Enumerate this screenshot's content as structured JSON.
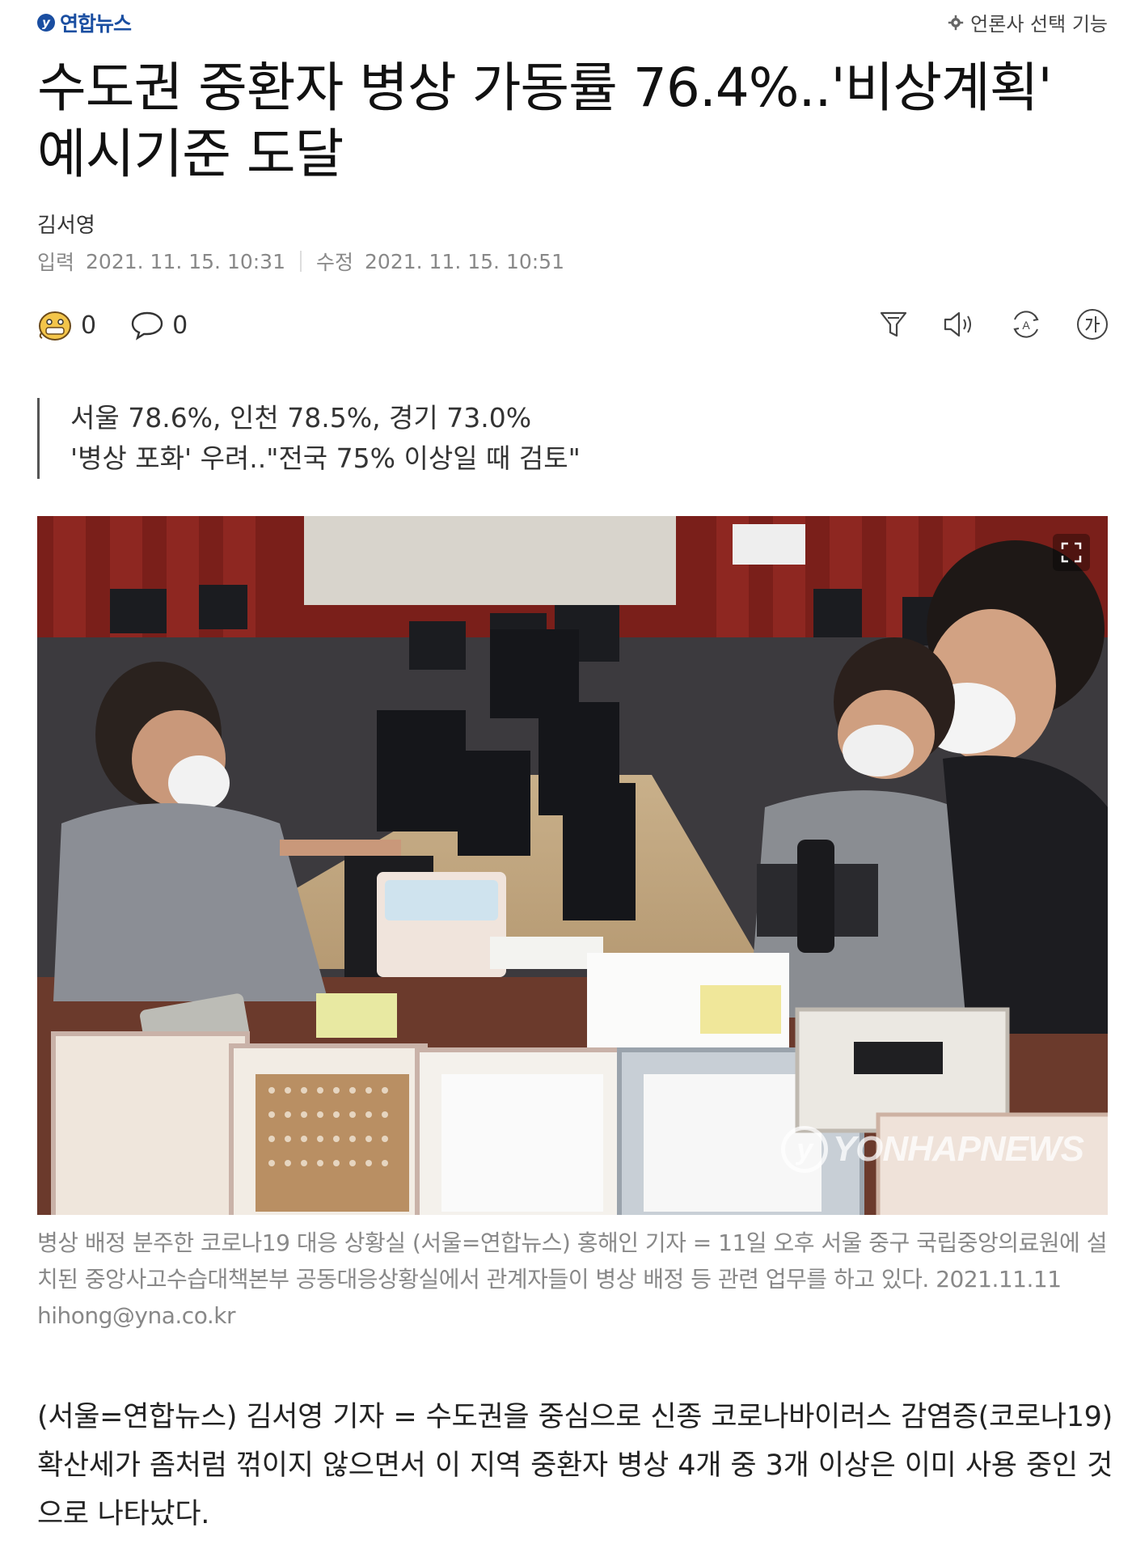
{
  "header": {
    "logo_mark": "y",
    "logo_text": "연합뉴스",
    "press_select_label": "언론사 선택 기능"
  },
  "article": {
    "headline": "수도권 중환자 병상 가동률 76.4%..'비상계획' 예시기준 도달",
    "author": "김서영",
    "published_label": "입력",
    "published_time": "2021. 11. 15. 10:31",
    "modified_label": "수정",
    "modified_time": "2021. 11. 15. 10:51",
    "reaction_count": "0",
    "comment_count": "0",
    "summary_lines": [
      "서울 78.6%, 인천 78.5%, 경기 73.0%",
      "'병상 포화' 우려..\"전국 75% 이상일 때 검토\""
    ],
    "photo_watermark": "YONHAPNEWS",
    "photo_watermark_mark": "y",
    "caption": "병상 배정 분주한 코로나19 대응 상황실 (서울=연합뉴스) 홍해인 기자 = 11일 오후 서울 중구 국립중앙의료원에 설치된 중앙사고수습대책본부 공동대응상황실에서 관계자들이 병상 배정 등 관련 업무를 하고 있다. 2021.11.11 hihong@yna.co.kr",
    "body": "(서울=연합뉴스) 김서영 기자 = 수도권을 중심으로 신종 코로나바이러스 감염증(코로나19) 확산세가 좀처럼 꺾이지 않으면서 이 지역 중환자 병상 4개 중 3개 이상은 이미 사용 중인 것으로 나타났다."
  },
  "icons": {
    "logo": "yonhap-logo-icon",
    "press_select": "gear-icon",
    "reaction": "emoji-face-icon",
    "comment": "comment-bubble-icon",
    "summarize": "summary-filter-icon",
    "listen": "speaker-icon",
    "translate": "translate-icon",
    "font_size": "font-size-icon",
    "expand": "expand-icon"
  },
  "colors": {
    "brand": "#1a4ea1",
    "text": "#222222",
    "muted": "#888888"
  }
}
